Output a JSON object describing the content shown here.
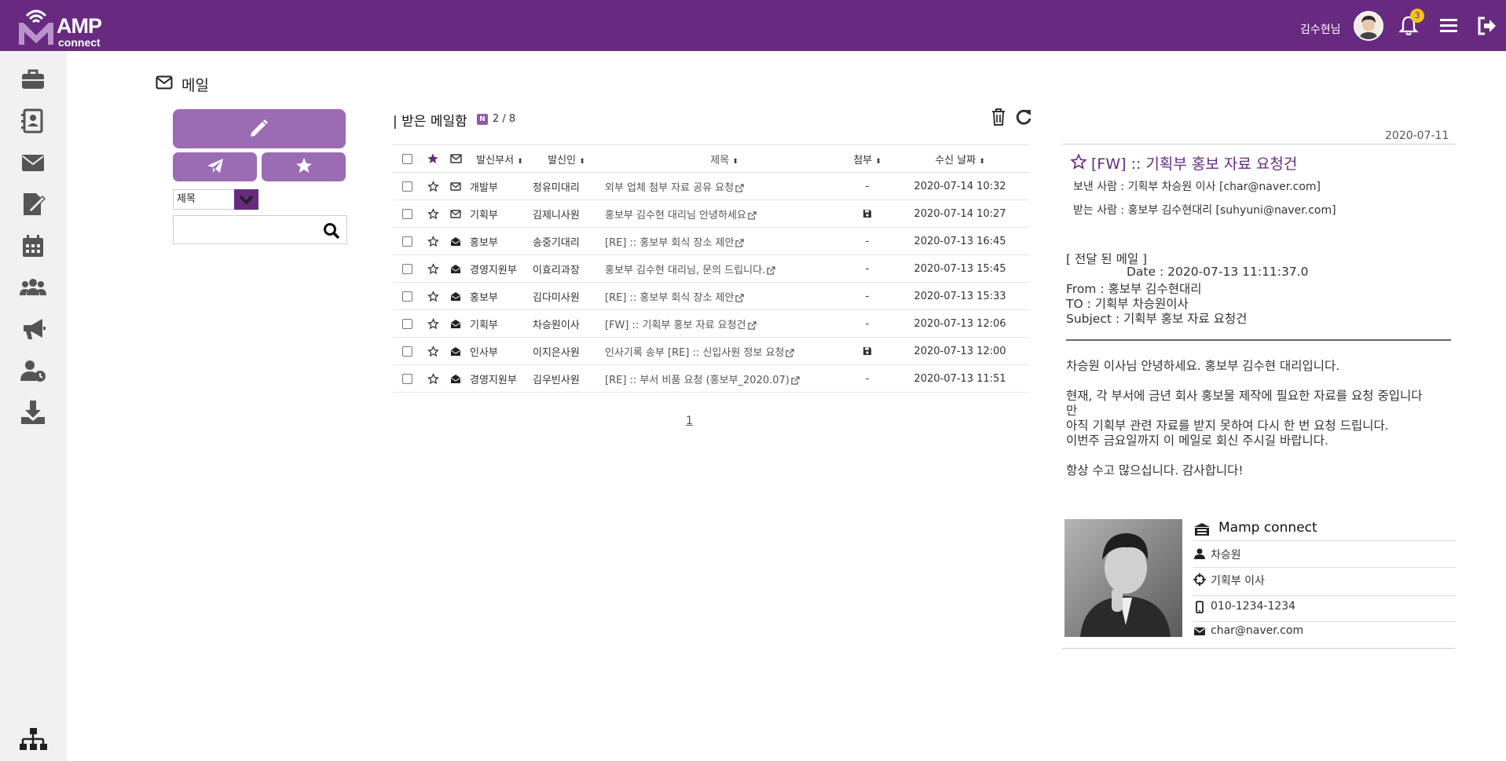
{
  "header": {
    "logo_main": "AMP",
    "logo_sub": "connect",
    "user_name": "김수현님",
    "notification_count": "3"
  },
  "page": {
    "title": "메일"
  },
  "left_panel": {
    "search_field_option": "제목",
    "search_placeholder": ""
  },
  "mailbox": {
    "title": "| 받은 메일함",
    "new_badge": "N",
    "count": "2 / 8",
    "columns": {
      "dept": "발신부서",
      "sender": "발신인",
      "subject": "제목",
      "attachment": "첨부",
      "date": "수신 날짜"
    },
    "rows": [
      {
        "dept": "개발부",
        "sender": "정유미대리",
        "subject": "외부 업체 첨부 자료 공유 요청",
        "attachment": "-",
        "date": "2020-07-14 10:32",
        "read": false
      },
      {
        "dept": "기획부",
        "sender": "김제니사원",
        "subject": "홍보부 김수현 대리님 안녕하세요",
        "attachment": "floppy",
        "date": "2020-07-14 10:27",
        "read": false
      },
      {
        "dept": "홍보부",
        "sender": "송중기대리",
        "subject": "[RE] :: 홍보부 회식 장소 제안",
        "attachment": "-",
        "date": "2020-07-13 16:45",
        "read": true
      },
      {
        "dept": "경영지원부",
        "sender": "이효리과장",
        "subject": "홍보부 김수현 대리님, 문의 드립니다.",
        "attachment": "-",
        "date": "2020-07-13 15:45",
        "read": true
      },
      {
        "dept": "홍보부",
        "sender": "김다미사원",
        "subject": "[RE] :: 홍보부 회식 장소 제안",
        "attachment": "-",
        "date": "2020-07-13 15:33",
        "read": true
      },
      {
        "dept": "기획부",
        "sender": "차승원이사",
        "subject": "[FW] :: 기획부 홍보 자료 요청건",
        "attachment": "-",
        "date": "2020-07-13 12:06",
        "read": true
      },
      {
        "dept": "인사부",
        "sender": "이지은사원",
        "subject": "인사기록 송부 [RE] :: 신입사원 정보 요청",
        "attachment": "floppy",
        "date": "2020-07-13 12:00",
        "read": true
      },
      {
        "dept": "경영지원부",
        "sender": "김우빈사원",
        "subject": "[RE] :: 부서 비품 요청 (홍보부_2020.07)",
        "attachment": "-",
        "date": "2020-07-13 11:51",
        "read": true
      }
    ],
    "page_number": "1"
  },
  "reading_pane": {
    "date": "2020-07-11",
    "subject": "[FW] :: 기획부 홍보 자료 요청건",
    "from_line": "보낸 사람 : 기획부 차승원 이사 [char@naver.com]",
    "to_line": "받는 사람 : 홍보부 김수현대리 [suhyuni@naver.com]",
    "forward_header": "[ 전달 된 메일 ]",
    "fw_date": "Date : 2020-07-13 11:11:37.0",
    "fw_from": "From : 홍보부 김수현대리",
    "fw_to": "TO : 기획부 차승원이사",
    "fw_subject": "Subject : 기획부 홍보 자료 요청건",
    "body_1": "차승원 이사님 안녕하세요. 홍보부 김수현 대리입니다.",
    "body_2a": "현재, 각 부서에 금년 회사 홍보물 제작에 필요한 자료를 요청 중입니다",
    "body_2b": "만",
    "body_3": "아직 기획부 관련 자료를 받지 못하여 다시 한 번 요청 드립니다.",
    "body_4": "이번주 금요일까지 이 메일로 회신 주시길 바랍니다.",
    "body_5": "항상 수고 많으십니다. 감사합니다!",
    "signature": {
      "company": "Mamp connect",
      "name": "차승원",
      "position": "기획부  이사",
      "phone": "010-1234-1234",
      "email": "char@naver.com"
    }
  },
  "colors": {
    "brand": "#672a80",
    "button": "#9b6bb3",
    "badge": "#f3c21b",
    "sidebar_bg": "#f1f1f1"
  }
}
